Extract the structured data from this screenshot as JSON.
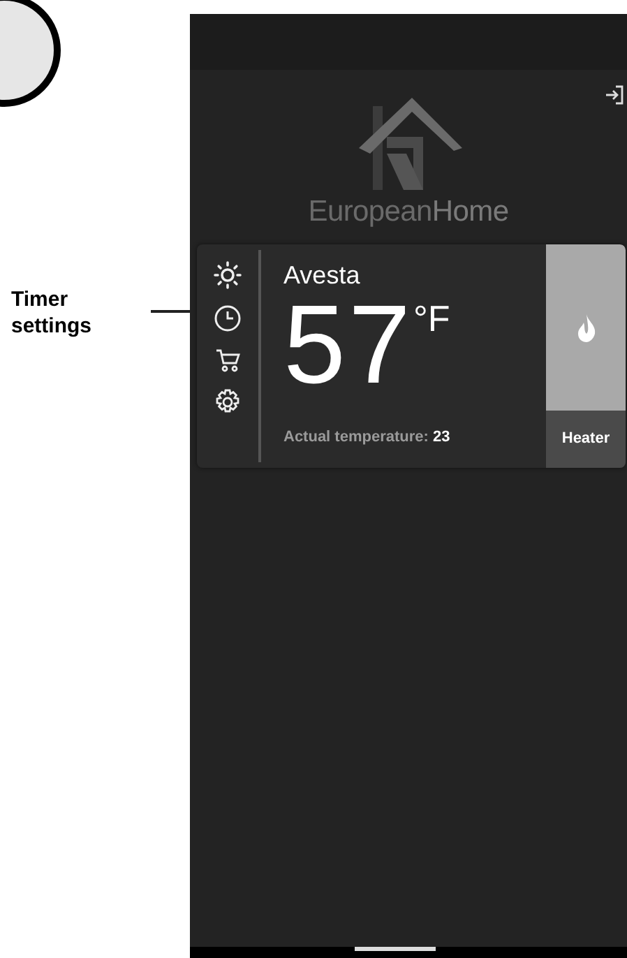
{
  "callout": {
    "label": "Timer settings"
  },
  "brand": {
    "first": "European",
    "second": "Home"
  },
  "thermostat": {
    "room": "Avesta",
    "temperature": "57",
    "unit": "°F",
    "actual": "Actual temperature: **23**"
  },
  "heater": {
    "label": "Heater",
    "on": true
  }
}
